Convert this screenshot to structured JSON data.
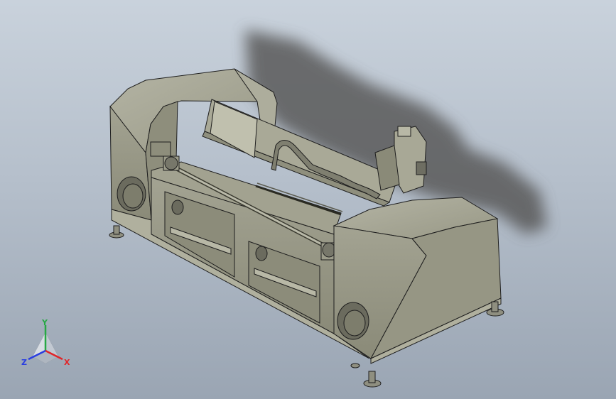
{
  "viewport": {
    "background_top": "#c9d2dc",
    "background_bottom": "#9aa5b3",
    "model_color": "#9a9a88",
    "model_edge_color": "#1e1e1e"
  },
  "triad": {
    "x_label": "X",
    "y_label": "Y",
    "z_label": "Z",
    "x_color": "#e0262a",
    "y_color": "#27a844",
    "z_color": "#2a3ee0"
  }
}
